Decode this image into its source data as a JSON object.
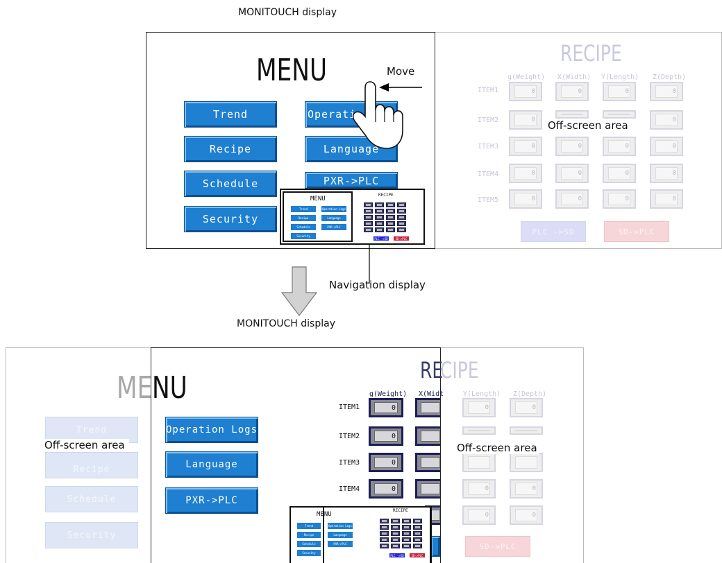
{
  "captions": {
    "top_display": "MONITOUCH display",
    "bottom_display": "MONITOUCH display",
    "move": "Move",
    "navigation": "Navigation display",
    "offscreen_top": "Off-screen area",
    "offscreen_bottom_left": "Off-screen area",
    "offscreen_bottom_right": "Off-screen area"
  },
  "menu": {
    "title": "MENU",
    "title_left": "ME",
    "title_right": "NU",
    "buttons": [
      "Trend",
      "Recipe",
      "Schedule",
      "Security",
      "Operation Logs",
      "Language",
      "PXR->PLC"
    ],
    "operation_partial": "Operati"
  },
  "recipe": {
    "title": "RECIPE",
    "title_left": "RE",
    "title_right": "CIPE",
    "columns": [
      "g(Weight)",
      "X(Width)",
      "Y(Length)",
      "Z(Depth)"
    ],
    "column_x_partial": "X(Widt",
    "rows": [
      "ITEM1",
      "ITEM2",
      "ITEM3",
      "ITEM4",
      "ITEM5"
    ],
    "cell_value": "0",
    "plc_to_sd": "PLC ->SD",
    "sd_to_plc": "SD->PLC"
  },
  "mini": {
    "menu_title": "MENU",
    "recipe_title": "RECIPE",
    "buttons": [
      "Trend",
      "Recipe",
      "Schedule",
      "Security",
      "Operation Logs",
      "Language",
      "PXR->PLC"
    ],
    "plc_to_sd": "PLC ->SD",
    "sd_to_plc": "SD->PLC"
  },
  "colors": {
    "button_blue": "#1f7fd0",
    "faded_button": "#dfe7f6",
    "sd_plc_pink": "#f7d6da",
    "plc_sd_lavender": "#dcdcf6"
  }
}
